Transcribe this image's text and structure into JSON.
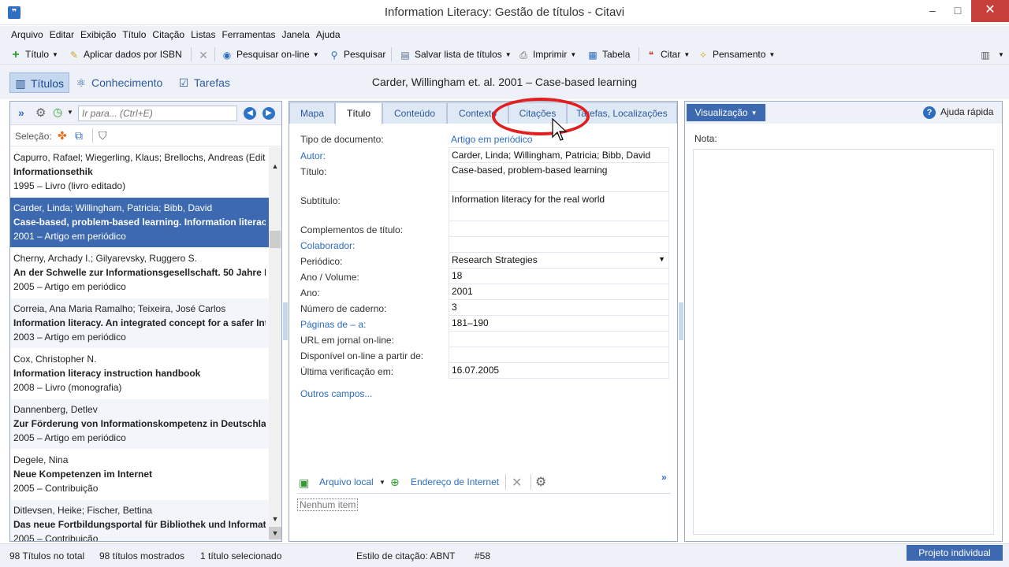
{
  "window": {
    "icon": "citavi-quote-icon",
    "title": "Information Literacy: Gestão de títulos - Citavi",
    "controls": {
      "minimize": "–",
      "maximize": "□",
      "close": "✕"
    }
  },
  "menu": [
    "Arquivo",
    "Editar",
    "Exibição",
    "Título",
    "Citação",
    "Listas",
    "Ferramentas",
    "Janela",
    "Ajuda"
  ],
  "toolbar": {
    "titulo": "Título",
    "isbn": "Aplicar dados por ISBN",
    "pesquisar_online": "Pesquisar on-line",
    "pesquisar": "Pesquisar",
    "salvar_lista": "Salvar lista de títulos",
    "imprimir": "Imprimir",
    "tabela": "Tabela",
    "citar": "Citar",
    "pensamento": "Pensamento"
  },
  "nav": {
    "titulos": "Títulos",
    "conhecimento": "Conhecimento",
    "tarefas": "Tarefas"
  },
  "record_title": "Carder, Willingham et. al. 2001 – Case-based learning",
  "left": {
    "goto_placeholder": "Ir para... (Ctrl+E)",
    "selecao": "Seleção:",
    "references": [
      {
        "authors": "Capurro, Rafael; Wiegerling, Klaus; Brellochs, Andreas (Edit",
        "title": "Informationsethik",
        "meta": "1995 – Livro (livro editado)"
      },
      {
        "authors": "Carder, Linda; Willingham, Patricia; Bibb, David",
        "title": "Case-based, problem-based learning. Information literacy",
        "meta": "2001 – Artigo em periódico"
      },
      {
        "authors": "Cherny, Archady I.; Gilyarevsky, Ruggero S.",
        "title": "An der Schwelle zur Informationsgesellschaft. 50 Jahre Er",
        "meta": "2005 – Artigo em periódico"
      },
      {
        "authors": "Correia, Ana Maria Ramalho; Teixeira, José Carlos",
        "title": "Information literacy. An integrated concept for a safer Int",
        "meta": "2003 – Artigo em periódico"
      },
      {
        "authors": "Cox, Christopher N.",
        "title": "Information literacy instruction handbook",
        "meta": "2008 – Livro (monografia)"
      },
      {
        "authors": "Dannenberg, Detlev",
        "title": "Zur Förderung von Informationskompetenz in Deutschlan",
        "meta": "2005 – Artigo em periódico"
      },
      {
        "authors": "Degele, Nina",
        "title": "Neue Kompetenzen im Internet",
        "meta": "2005 – Contribuição"
      },
      {
        "authors": "Ditlevsen, Heike; Fischer, Bettina",
        "title": "Das neue Fortbildungsportal für Bibliothek und Informat",
        "meta": "2005 – Contribuição"
      }
    ]
  },
  "tabs": [
    "Mapa",
    "Título",
    "Conteúdo",
    "Contexto",
    "Citações",
    "Tarefas, Localizações"
  ],
  "fields": {
    "tipo_label": "Tipo de documento:",
    "tipo_value": "Artigo em periódico",
    "autor_label": "Autor:",
    "autor_value": "Carder, Linda; Willingham, Patricia; Bibb, David",
    "titulo_label": "Título:",
    "titulo_value": "Case-based, problem-based learning",
    "subtitulo_label": "Subtítulo:",
    "subtitulo_value": "Information literacy for the real world",
    "complementos_label": "Complementos de título:",
    "colaborador_label": "Colaborador:",
    "periodico_label": "Periódico:",
    "periodico_value": "Research Strategies",
    "ano_volume_label": "Ano / Volume:",
    "ano_volume_value": "18",
    "ano_label": "Ano:",
    "ano_value": "2001",
    "caderno_label": "Número de caderno:",
    "caderno_value": "3",
    "paginas_label": "Páginas de – a:",
    "paginas_value": "181–190",
    "url_label": "URL em jornal on-line:",
    "disponivel_label": "Disponível on-line a partir de:",
    "verificacao_label": "Última verificação em:",
    "verificacao_value": "16.07.2005",
    "outros": "Outros campos..."
  },
  "attachments": {
    "arquivo_local": "Arquivo local",
    "endereco": "Endereço de Internet",
    "nenhum": "Nenhum item"
  },
  "right": {
    "visualizacao": "Visualização",
    "ajuda": "Ajuda rápida",
    "nota": "Nota:"
  },
  "status": {
    "total": "98 Títulos no total",
    "mostrados": "98 títulos mostrados",
    "selecionado": "1 título selecionado",
    "estilo": "Estilo de citação: ABNT",
    "numero": "#58",
    "projeto": "Projeto individual"
  },
  "colors": {
    "accent": "#3d69b0",
    "link": "#2d6dc0",
    "annotation": "#e02020"
  }
}
